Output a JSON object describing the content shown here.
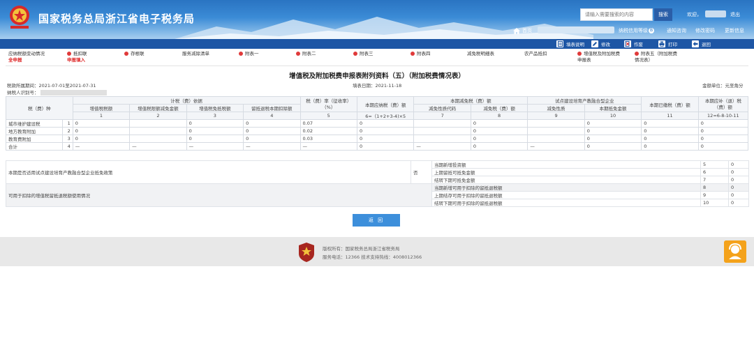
{
  "header": {
    "title": "国家税务总局浙江省电子税务局",
    "emblem_caption": "中国税务",
    "search_placeholder": "请输入需要搜索的内容",
    "search_button": "搜索",
    "welcome": "欢迎，",
    "logout": "退出",
    "home": "首页",
    "credit": "纳税信用等级",
    "credit_badge": "B",
    "notify": "通知咨询",
    "change_password": "修改密码",
    "update_info": "更新信息"
  },
  "toolbar": [
    "填表说明",
    "修改",
    "作废",
    "打印",
    "退回"
  ],
  "attachments": [
    {
      "label": "应纳税额变动情况",
      "sub": "全申报",
      "dot": false
    },
    {
      "label": "抵扣联",
      "sub": "申报填入",
      "dot": true
    },
    {
      "label": "存根联",
      "sub": "",
      "dot": true
    },
    {
      "label": "服务减除清单",
      "sub": "",
      "dot": false
    },
    {
      "label": "附表一",
      "sub": "",
      "dot": true
    },
    {
      "label": "附表二",
      "sub": "",
      "dot": true
    },
    {
      "label": "附表三",
      "sub": "",
      "dot": true
    },
    {
      "label": "附表四",
      "sub": "",
      "dot": true
    },
    {
      "label": "减免税明细表",
      "sub": "",
      "dot": false
    },
    {
      "label": "农产品抵扣",
      "sub": "",
      "dot": false
    },
    {
      "label": "增值税及附加税费",
      "sub": "申报表",
      "dot": true
    },
    {
      "label": "附表五（附加税费",
      "sub": "情况表）",
      "dot": true
    }
  ],
  "form": {
    "title": "增值税及附加税费申报表附列资料（五）（附加税费情况表）",
    "period": "税款所属期间：2021-07-01至2021-07-31",
    "fill_date": "填表日期：2021-11-18",
    "unit": "金额单位：元至角分",
    "taxpayer_id_label": "纳税人识别号："
  },
  "table": {
    "h_tax": "税（费）种",
    "h_basis": "计税（费）依据",
    "h_rate": "税（费）率（征收率）（%）",
    "h_payable": "本期应纳税（费）额",
    "h_relief": "本期减免税（费）额",
    "h_pilot": "试点建设培育产教融合型企业",
    "h_paid": "本期已缴税（费）额",
    "h_due": "本期应补（退）税（费）额",
    "sub_vat": "增值税税额",
    "sub_vat_relief": "增值税限额减免金额",
    "sub_vat_exempt": "增值税免抵税额",
    "sub_refund": "留抵退税本期扣除额",
    "sub_relief_code": "减免性质代码",
    "sub_relief_amt": "减免税（费）额",
    "sub_pilot_code": "减免性质",
    "sub_pilot_amt": "本期抵免金额",
    "c1": "1",
    "c2": "2",
    "c3": "3",
    "c4": "4",
    "c5": "5",
    "c6": "6=（1+2+3-4)×5",
    "c7": "7",
    "c8": "8",
    "c9": "9",
    "c10": "10",
    "c11": "11",
    "c12": "12=6-8-10-11",
    "rows": [
      {
        "name": "城市维护建设税",
        "no": "1",
        "v1": "0",
        "v2": "",
        "v3": "0",
        "v4": "0",
        "rate": "0.07",
        "v6": "0",
        "v7": "",
        "v8": "0",
        "v9": "",
        "v10": "0",
        "v11": "0",
        "v12": "0"
      },
      {
        "name": "地方教育附加",
        "no": "2",
        "v1": "0",
        "v2": "",
        "v3": "0",
        "v4": "0",
        "rate": "0.02",
        "v6": "0",
        "v7": "",
        "v8": "0",
        "v9": "",
        "v10": "0",
        "v11": "0",
        "v12": "0"
      },
      {
        "name": "教育费附加",
        "no": "3",
        "v1": "0",
        "v2": "",
        "v3": "0",
        "v4": "0",
        "rate": "0.03",
        "v6": "0",
        "v7": "",
        "v8": "0",
        "v9": "",
        "v10": "0",
        "v11": "0",
        "v12": "0"
      },
      {
        "name": "合计",
        "no": "4",
        "v1": "—",
        "v2": "—",
        "v3": "—",
        "v4": "—",
        "rate": "—",
        "v6": "0",
        "v7": "—",
        "v8": "0",
        "v9": "—",
        "v10": "0",
        "v11": "0",
        "v12": "0"
      }
    ]
  },
  "sub": {
    "q1": "本期是否适用试点建设培育产教融合型企业抵免政策",
    "q1_answer": "否",
    "q2": "可用于扣除的增值税留抵退税额使用情况",
    "items": [
      {
        "label": "当期新增投资额",
        "no": "5",
        "val": "0"
      },
      {
        "label": "上期留抵可抵免金额",
        "no": "6",
        "val": "0"
      },
      {
        "label": "结转下期可抵免金额",
        "no": "7",
        "val": "0"
      },
      {
        "label": "当期新增可用于扣除的留抵退税额",
        "no": "8",
        "val": "0"
      },
      {
        "label": "上期结存可用于扣除的留抵退税额",
        "no": "9",
        "val": "0"
      },
      {
        "label": "结转下期可用于扣除的留抵退税额",
        "no": "10",
        "val": "0"
      }
    ]
  },
  "return_button": "返 回",
  "footer": {
    "copyright": "版权所有：国家税务总局浙江省税务局",
    "service": "服务电话：12366 技术支持热线：4008012366"
  }
}
